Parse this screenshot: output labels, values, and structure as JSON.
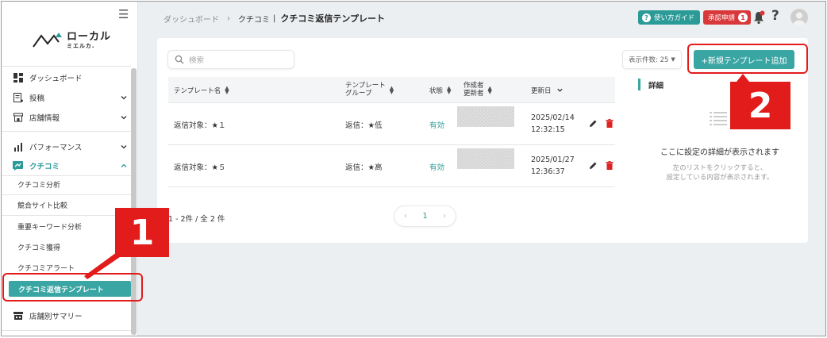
{
  "colors": {
    "accent": "#3aa6a4",
    "accent_dark": "#2b9b98",
    "approval_red": "#d9383a",
    "annotation_red": "#e21b1b",
    "background": "#eceff1"
  },
  "sidebar": {
    "logo_main": "ローカル",
    "logo_sub": "ミエルカ.",
    "items": [
      {
        "label": "ダッシュボード",
        "icon": "dashboard-icon"
      },
      {
        "label": "投稿",
        "icon": "post-icon"
      },
      {
        "label": "店舗情報",
        "icon": "store-icon"
      },
      {
        "label": "パフォーマンス",
        "icon": "bar-chart-icon"
      },
      {
        "label": "クチコミ",
        "icon": "review-icon"
      }
    ],
    "sub_items": [
      "クチコミ分析",
      "競合サイト比較",
      "重要キーワード分析",
      "クチコミ獲得",
      "クチコミアラート",
      "クチコミ返信テンプレート"
    ],
    "bottom_item": {
      "label": "店舗別サマリー",
      "icon": "summary-icon"
    }
  },
  "header": {
    "breadcrumb": [
      "ダッシュボード",
      "クチコミ",
      "クチコミ返信テンプレート"
    ],
    "help_label": "使い方ガイド",
    "approval_label": "承認申請",
    "approval_count": "1"
  },
  "main": {
    "search_placeholder": "検索",
    "per_page_label": "表示件数: 25",
    "add_button_label": "+新規テンプレート追加",
    "table": {
      "headers": {
        "name": "テンプレート名",
        "group_line1": "テンプレート",
        "group_line2": "グループ",
        "status": "状態",
        "author_line1": "作成者",
        "author_line2": "更新者",
        "updated": "更新日"
      },
      "rows": [
        {
          "name": "返信対象：★１",
          "group": "返信：★低",
          "status": "有効",
          "date": "2025/02/14",
          "time": "12:32:15"
        },
        {
          "name": "返信対象：★５",
          "group": "返信：★高",
          "status": "有効",
          "date": "2025/01/27",
          "time": "12:36:37"
        }
      ]
    },
    "pager_info": "1 - 2件 / 全 2 件",
    "current_page": "1"
  },
  "detail": {
    "title": "詳細",
    "main_text": "ここに設定の詳細が表示されます",
    "sub_line1": "左のリストをクリックすると、",
    "sub_line2": "設定している内容が表示されます。"
  },
  "annotations": {
    "label_1": "1",
    "label_2": "2"
  }
}
